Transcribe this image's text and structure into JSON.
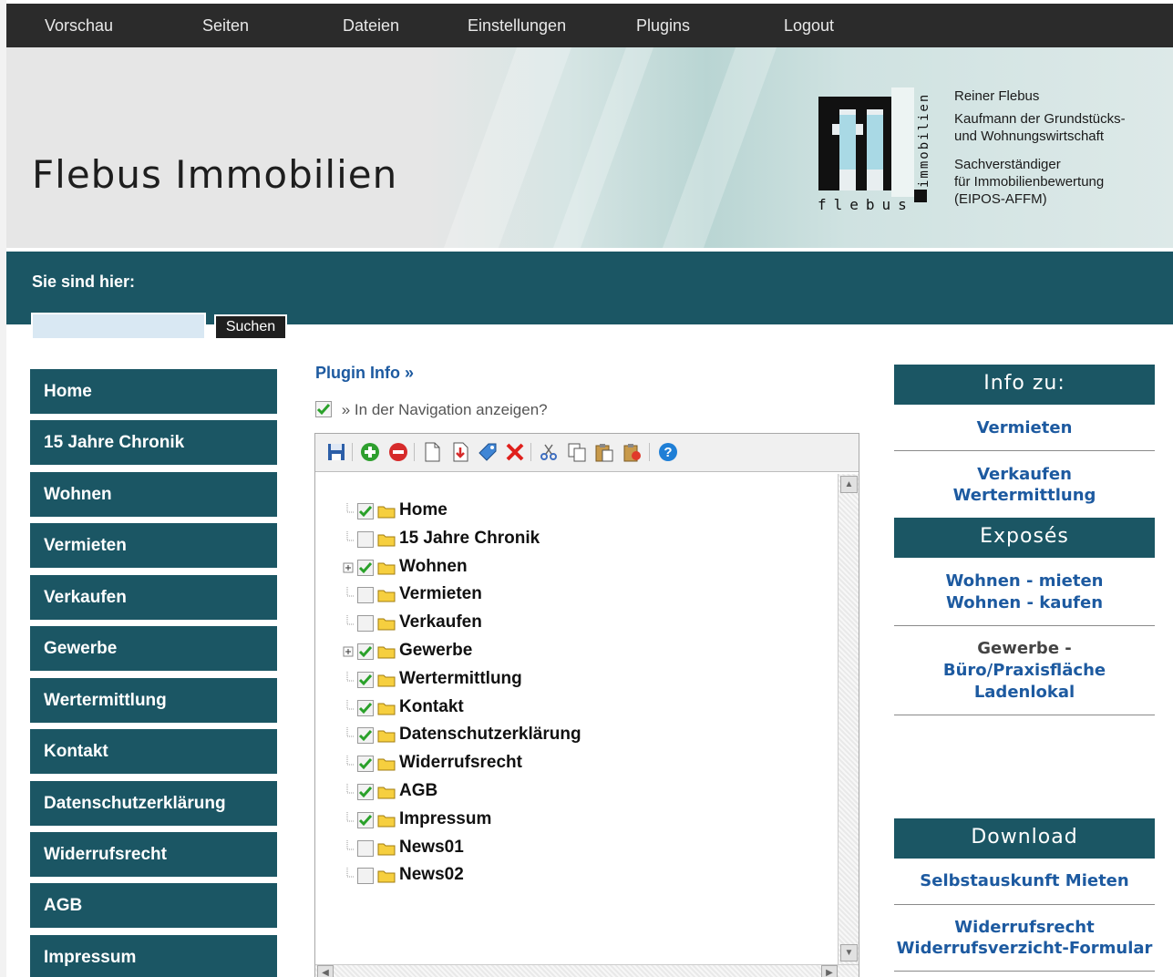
{
  "topnav": {
    "items": [
      {
        "label": "Vorschau"
      },
      {
        "label": "Seiten"
      },
      {
        "label": "Dateien"
      },
      {
        "label": "Einstellungen"
      },
      {
        "label": "Plugins"
      },
      {
        "label": "Logout"
      }
    ]
  },
  "header": {
    "site_title": "Flebus Immobilien",
    "logo_text_bottom": "flebus",
    "logo_text_side": "immobilien",
    "contact": {
      "name": "Reiner Flebus",
      "role_line1": "Kaufmann der Grundstücks-",
      "role_line2": "und Wohnungswirtschaft",
      "expert_line1": "Sachverständiger",
      "expert_line2": "für Immobilienbewertung",
      "expert_line3": "(EIPOS-AFFM)"
    }
  },
  "breadcrumb": {
    "label": "Sie sind hier:"
  },
  "search": {
    "value": "",
    "placeholder": "",
    "button_label": "Suchen"
  },
  "left_menu": {
    "items": [
      {
        "label": "Home"
      },
      {
        "label": "15 Jahre Chronik"
      },
      {
        "label": "Wohnen"
      },
      {
        "label": "Vermieten"
      },
      {
        "label": "Verkaufen"
      },
      {
        "label": "Gewerbe"
      },
      {
        "label": "Wertermittlung"
      },
      {
        "label": "Kontakt"
      },
      {
        "label": "Datenschutzerklärung"
      },
      {
        "label": "Widerrufsrecht"
      },
      {
        "label": "AGB"
      },
      {
        "label": "Impressum"
      }
    ]
  },
  "main": {
    "plugin_info_label": "Plugin Info »",
    "nav_show_label": "» In der Navigation anzeigen?",
    "nav_show_checked": true,
    "toolbar_icons": [
      "save-icon",
      "add-icon",
      "remove-icon",
      "new-page-icon",
      "import-icon",
      "tag-icon",
      "delete-icon",
      "cut-icon",
      "copy-icon",
      "paste-icon",
      "paste-into-icon",
      "help-icon"
    ],
    "tree": [
      {
        "label": "Home",
        "checked": true,
        "expandable": false
      },
      {
        "label": "15 Jahre Chronik",
        "checked": false,
        "expandable": false
      },
      {
        "label": "Wohnen",
        "checked": true,
        "expandable": true
      },
      {
        "label": "Vermieten",
        "checked": false,
        "expandable": false
      },
      {
        "label": "Verkaufen",
        "checked": false,
        "expandable": false
      },
      {
        "label": "Gewerbe",
        "checked": true,
        "expandable": true
      },
      {
        "label": "Wertermittlung",
        "checked": true,
        "expandable": false
      },
      {
        "label": "Kontakt",
        "checked": true,
        "expandable": false
      },
      {
        "label": "Datenschutzerklärung",
        "checked": true,
        "expandable": false
      },
      {
        "label": "Widerrufsrecht",
        "checked": true,
        "expandable": false
      },
      {
        "label": "AGB",
        "checked": true,
        "expandable": false
      },
      {
        "label": "Impressum",
        "checked": true,
        "expandable": false
      },
      {
        "label": "News01",
        "checked": false,
        "expandable": false
      },
      {
        "label": "News02",
        "checked": false,
        "expandable": false
      }
    ]
  },
  "sidebar": {
    "info_heading": "Info zu:",
    "info_link_1": "Vermieten",
    "info_link_2a": "Verkaufen",
    "info_link_2b": "Wertermittlung",
    "expose_heading": "Exposés",
    "expose_link_1": "Wohnen - mieten",
    "expose_link_2": "Wohnen - kaufen",
    "expose_text": "Gewerbe -",
    "expose_link_3": "Büro/Praxisfläche",
    "expose_link_4": "Ladenlokal",
    "download_heading": "Download",
    "download_link_1": "Selbstauskunft Mieten",
    "download_link_2": "Widerrufsrecht",
    "download_link_3": "Widerrufsverzicht-Formular"
  },
  "colors": {
    "teal": "#1b5664",
    "link_blue": "#1d5aa0",
    "nav_dark": "#2b2b2b"
  }
}
